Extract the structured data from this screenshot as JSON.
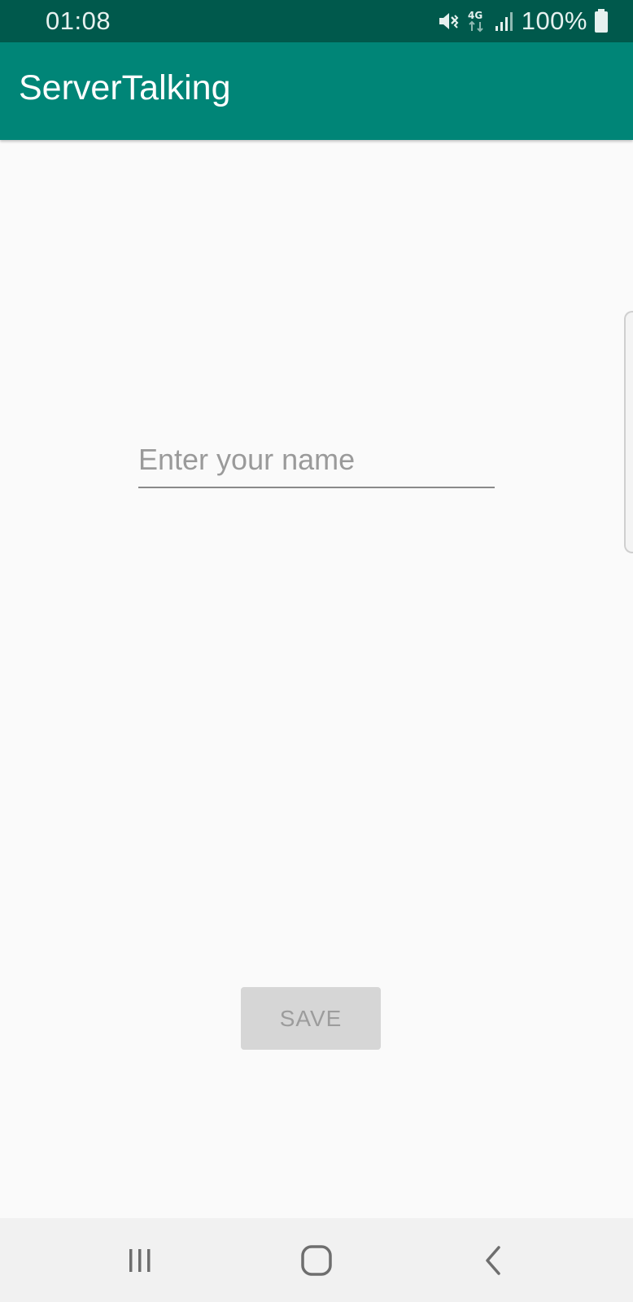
{
  "status_bar": {
    "time": "01:08",
    "battery_percent": "100%",
    "network_label": "4G",
    "icons": [
      "mute-vibrate-icon",
      "4g-data-icon",
      "signal-strength-icon",
      "battery-icon"
    ],
    "background_color": "#00594c"
  },
  "app_bar": {
    "title": "ServerTalking",
    "background_color": "#008577"
  },
  "form": {
    "name_input": {
      "placeholder": "Enter your name",
      "value": ""
    },
    "save_label": "SAVE",
    "save_enabled": false
  },
  "nav_bar": {
    "buttons": [
      "recent-apps-icon",
      "home-icon",
      "back-icon"
    ]
  }
}
